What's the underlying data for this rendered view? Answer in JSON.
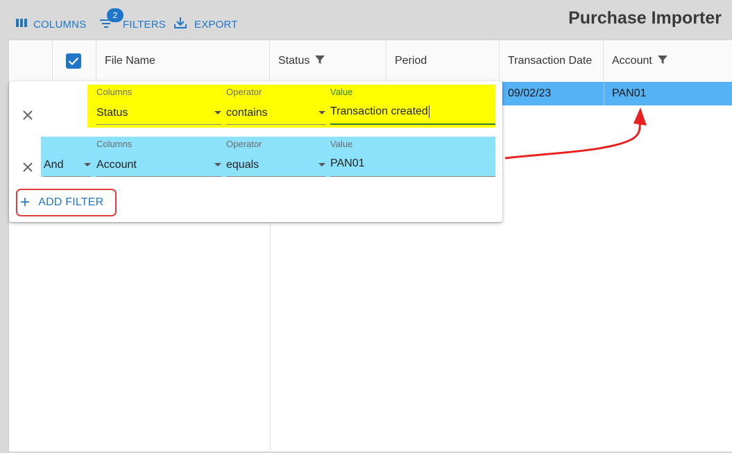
{
  "toolbar": {
    "columns_label": "COLUMNS",
    "filters_label": "FILTERS",
    "filters_badge": "2",
    "export_label": "EXPORT"
  },
  "app_title": "Purchase Importer",
  "grid": {
    "columns": [
      "File Name",
      "Status",
      "Period",
      "Transaction Date",
      "Account"
    ],
    "selected_row": {
      "transaction_date": "09/02/23",
      "account": "PAN01"
    }
  },
  "filter_panel": {
    "rows": [
      {
        "columns_label": "Columns",
        "columns_value": "Status",
        "operator_label": "Operator",
        "operator_value": "contains",
        "value_label": "Value",
        "value_value": "Transaction created",
        "highlight_color": "#ffff00"
      },
      {
        "logic_value": "And",
        "columns_label": "Columns",
        "columns_value": "Account",
        "operator_label": "Operator",
        "operator_value": "equals",
        "value_label": "Value",
        "value_value": "PAN01",
        "highlight_color": "#8ce1fb"
      }
    ],
    "add_filter_label": "ADD FILTER"
  },
  "colors": {
    "accent": "#1f76c9",
    "selected_row": "#55b2f5",
    "annotation": "#e82020"
  }
}
